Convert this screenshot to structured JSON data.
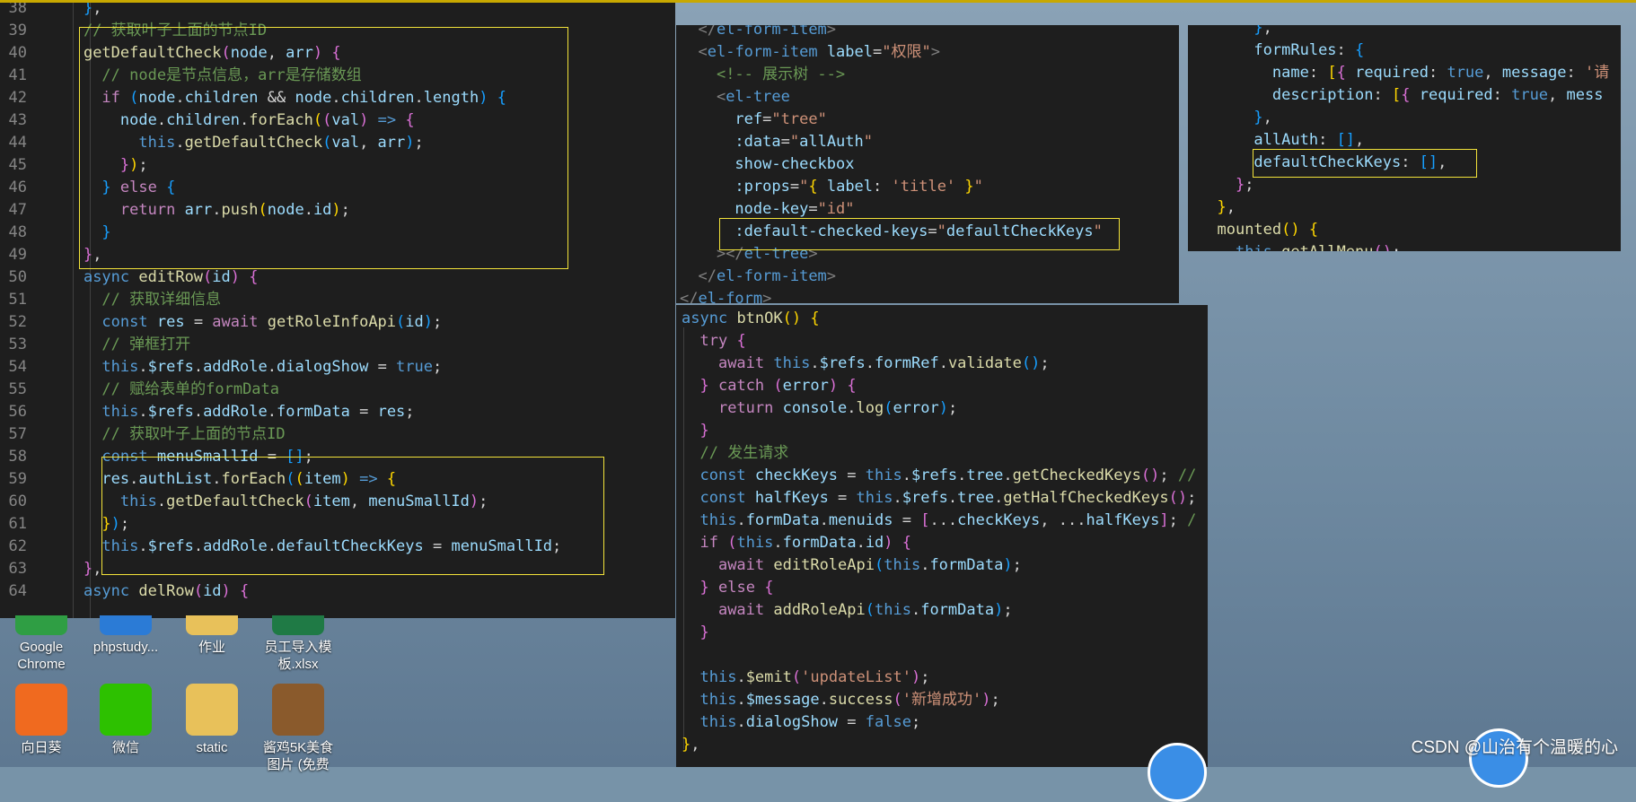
{
  "panel_left": {
    "lines": [
      {
        "n": "38",
        "html": "    <span class='b3'>}</span>,"
      },
      {
        "n": "39",
        "html": "    <span class='c'>// 获取叶子上面的节点ID</span>"
      },
      {
        "n": "40",
        "html": "    <span class='f'>getDefaultCheck</span><span class='b2'>(</span><span class='v'>node</span>, <span class='v'>arr</span><span class='b2'>)</span> <span class='b2'>{</span>"
      },
      {
        "n": "41",
        "html": "      <span class='c'>// node是节点信息，arr是存储数组</span>"
      },
      {
        "n": "42",
        "html": "      <span class='cl'>if</span> <span class='b3'>(</span><span class='v'>node</span>.<span class='v'>children</span> &amp;&amp; <span class='v'>node</span>.<span class='v'>children</span>.<span class='v'>length</span><span class='b3'>)</span> <span class='b3'>{</span>"
      },
      {
        "n": "43",
        "html": "        <span class='v'>node</span>.<span class='v'>children</span>.<span class='f'>forEach</span><span class='b1'>(</span><span class='b2'>(</span><span class='v'>val</span><span class='b2'>)</span> <span class='k'>=&gt;</span> <span class='b2'>{</span>"
      },
      {
        "n": "44",
        "html": "          <span class='k'>this</span>.<span class='f'>getDefaultCheck</span><span class='b3'>(</span><span class='v'>val</span>, <span class='v'>arr</span><span class='b3'>)</span>;"
      },
      {
        "n": "45",
        "html": "        <span class='b2'>}</span><span class='b1'>)</span>;"
      },
      {
        "n": "46",
        "html": "      <span class='b3'>}</span> <span class='cl'>else</span> <span class='b3'>{</span>"
      },
      {
        "n": "47",
        "html": "        <span class='cl'>return</span> <span class='v'>arr</span>.<span class='f'>push</span><span class='b1'>(</span><span class='v'>node</span>.<span class='v'>id</span><span class='b1'>)</span>;"
      },
      {
        "n": "48",
        "html": "      <span class='b3'>}</span>"
      },
      {
        "n": "49",
        "html": "    <span class='b2'>}</span>,"
      },
      {
        "n": "50",
        "html": "    <span class='k'>async</span> <span class='f'>editRow</span><span class='b2'>(</span><span class='v'>id</span><span class='b2'>)</span> <span class='b2'>{</span>"
      },
      {
        "n": "51",
        "html": "      <span class='c'>// 获取详细信息</span>"
      },
      {
        "n": "52",
        "html": "      <span class='k'>const</span> <span class='v'>res</span> = <span class='cl'>await</span> <span class='f'>getRoleInfoApi</span><span class='b3'>(</span><span class='v'>id</span><span class='b3'>)</span>;"
      },
      {
        "n": "53",
        "html": "      <span class='c'>// 弹框打开</span>"
      },
      {
        "n": "54",
        "html": "      <span class='k'>this</span>.<span class='v'>$refs</span>.<span class='v'>addRole</span>.<span class='v'>dialogShow</span> = <span class='k'>true</span>;"
      },
      {
        "n": "55",
        "html": "      <span class='c'>// 赋给表单的formData</span>"
      },
      {
        "n": "56",
        "html": "      <span class='k'>this</span>.<span class='v'>$refs</span>.<span class='v'>addRole</span>.<span class='v'>formData</span> = <span class='v'>res</span>;"
      },
      {
        "n": "57",
        "html": "      <span class='c'>// 获取叶子上面的节点ID</span>"
      },
      {
        "n": "58",
        "html": "      <span class='k'>const</span> <span class='v'>menuSmallId</span> = <span class='b3'>[]</span>;"
      },
      {
        "n": "59",
        "html": "      <span class='v'>res</span>.<span class='v'>authList</span>.<span class='f'>forEach</span><span class='b3'>(</span><span class='b1'>(</span><span class='v'>item</span><span class='b1'>)</span> <span class='k'>=&gt;</span> <span class='b1'>{</span>"
      },
      {
        "n": "60",
        "html": "        <span class='k'>this</span>.<span class='f'>getDefaultCheck</span><span class='b2'>(</span><span class='v'>item</span>, <span class='v'>menuSmallId</span><span class='b2'>)</span>;"
      },
      {
        "n": "61",
        "html": "      <span class='b1'>}</span><span class='b3'>)</span>;"
      },
      {
        "n": "62",
        "html": "      <span class='k'>this</span>.<span class='v'>$refs</span>.<span class='v'>addRole</span>.<span class='v'>defaultCheckKeys</span> = <span class='v'>menuSmallId</span>;"
      },
      {
        "n": "63",
        "html": "    <span class='b2'>}</span>,"
      },
      {
        "n": "64",
        "html": "    <span class='k'>async</span> <span class='f'>delRow</span><span class='b2'>(</span><span class='v'>id</span><span class='b2'>)</span> <span class='b2'>{</span>"
      }
    ]
  },
  "panel_mid_top": {
    "lines": [
      "  <span class='g'>&lt;/</span><span class='t'>el-form-item</span><span class='g'>&gt;</span>",
      "  <span class='g'>&lt;</span><span class='t'>el-form-item</span> <span class='a'>label</span>=<span class='s'>\"权限\"</span><span class='g'>&gt;</span>",
      "    <span class='c'>&lt;!-- 展示树 --&gt;</span>",
      "    <span class='g'>&lt;</span><span class='t'>el-tree</span>",
      "      <span class='a'>ref</span>=<span class='s'>\"tree\"</span>",
      "      <span class='a'>:data</span>=<span class='s'>\"</span><span class='v'>allAuth</span><span class='s'>\"</span>",
      "      <span class='a'>show-checkbox</span>",
      "      <span class='a'>:props</span>=<span class='s'>\"</span><span class='b1'>{</span> <span class='v'>label</span>: <span class='s'>'title'</span> <span class='b1'>}</span><span class='s'>\"</span>",
      "      <span class='a'>node-key</span>=<span class='s'>\"id\"</span>",
      "      <span class='a'>:default-checked-keys</span>=<span class='s'>\"</span><span class='v'>defaultCheckKeys</span><span class='s'>\"</span>",
      "    <span class='g'>&gt;&lt;/</span><span class='t'>el-tree</span><span class='g'>&gt;</span>",
      "  <span class='g'>&lt;/</span><span class='t'>el-form-item</span><span class='g'>&gt;</span>",
      "<span class='g'>&lt;/</span><span class='t'>el-form</span><span class='g'>&gt;</span>"
    ]
  },
  "panel_right_top": {
    "lines": [
      "      <span class='b3'>}</span>,",
      "      <span class='v'>formRules</span>: <span class='b3'>{</span>",
      "        <span class='v'>name</span>: <span class='b1'>[</span><span class='b2'>{</span> <span class='v'>required</span>: <span class='k'>true</span>, <span class='v'>message</span>: <span class='s'>'请</span>",
      "        <span class='v'>description</span>: <span class='b1'>[</span><span class='b2'>{</span> <span class='v'>required</span>: <span class='k'>true</span>, <span class='v'>mess</span>",
      "      <span class='b3'>}</span>,",
      "      <span class='v'>allAuth</span>: <span class='b3'>[]</span>,",
      "      <span class='v'>defaultCheckKeys</span>: <span class='b3'>[]</span>,",
      "    <span class='b2'>}</span>;",
      "  <span class='b1'>}</span>,",
      "  <span class='f'>mounted</span><span class='b1'>()</span> <span class='b1'>{</span>",
      "    <span class='k'>this</span>.<span class='f'>getAllMenu</span><span class='b2'>()</span>;"
    ]
  },
  "panel_mid_bottom": {
    "lines": [
      "<span class='k'>async</span> <span class='f'>btnOK</span><span class='b1'>()</span> <span class='b1'>{</span>",
      "  <span class='cl'>try</span> <span class='b2'>{</span>",
      "    <span class='cl'>await</span> <span class='k'>this</span>.<span class='v'>$refs</span>.<span class='v'>formRef</span>.<span class='f'>validate</span><span class='b3'>()</span>;",
      "  <span class='b2'>}</span> <span class='cl'>catch</span> <span class='b2'>(</span><span class='v'>error</span><span class='b2'>)</span> <span class='b2'>{</span>",
      "    <span class='cl'>return</span> <span class='v'>console</span>.<span class='f'>log</span><span class='b3'>(</span><span class='v'>error</span><span class='b3'>)</span>;",
      "  <span class='b2'>}</span>",
      "  <span class='c'>// 发生请求</span>",
      "  <span class='k'>const</span> <span class='v'>checkKeys</span> = <span class='k'>this</span>.<span class='v'>$refs</span>.<span class='v'>tree</span>.<span class='f'>getCheckedKeys</span><span class='b2'>()</span>; <span class='c'>//</span>",
      "  <span class='k'>const</span> <span class='v'>halfKeys</span> = <span class='k'>this</span>.<span class='v'>$refs</span>.<span class='v'>tree</span>.<span class='f'>getHalfCheckedKeys</span><span class='b2'>()</span>;",
      "  <span class='k'>this</span>.<span class='v'>formData</span>.<span class='v'>menuids</span> = <span class='b2'>[</span>...<span class='v'>checkKeys</span>, ...<span class='v'>halfKeys</span><span class='b2'>]</span>; <span class='c'>/</span>",
      "  <span class='cl'>if</span> <span class='b2'>(</span><span class='k'>this</span>.<span class='v'>formData</span>.<span class='v'>id</span><span class='b2'>)</span> <span class='b2'>{</span>",
      "    <span class='cl'>await</span> <span class='f'>editRoleApi</span><span class='b3'>(</span><span class='k'>this</span>.<span class='v'>formData</span><span class='b3'>)</span>;",
      "  <span class='b2'>}</span> <span class='cl'>else</span> <span class='b2'>{</span>",
      "    <span class='cl'>await</span> <span class='f'>addRoleApi</span><span class='b3'>(</span><span class='k'>this</span>.<span class='v'>formData</span><span class='b3'>)</span>;",
      "  <span class='b2'>}</span>",
      "",
      "  <span class='k'>this</span>.<span class='f'>$emit</span><span class='b2'>(</span><span class='s'>'updateList'</span><span class='b2'>)</span>;",
      "  <span class='k'>this</span>.<span class='v'>$message</span>.<span class='f'>success</span><span class='b2'>(</span><span class='s'>'新增成功'</span><span class='b2'>)</span>;",
      "  <span class='k'>this</span>.<span class='v'>dialogShow</span> = <span class='k'>false</span>;",
      "<span class='b1'>}</span>,"
    ]
  },
  "desktop_icons": [
    {
      "label": "Google Chrome",
      "icon": "chrome-icon",
      "color": "#2f9e44"
    },
    {
      "label": "phpstudy...",
      "icon": "phpstudy-icon",
      "color": "#2b7bd6"
    },
    {
      "label": "作业",
      "icon": "folder-icon",
      "color": "#e8c15a"
    },
    {
      "label": "员工导入模板.xlsx",
      "icon": "excel-icon",
      "color": "#1f7a45"
    },
    {
      "label": "向日葵",
      "icon": "sunflower-icon",
      "color": "#f06a1f"
    },
    {
      "label": "微信",
      "icon": "wechat-icon",
      "color": "#2dc100"
    },
    {
      "label": "static",
      "icon": "folder-icon",
      "color": "#e8c15a"
    },
    {
      "label": "酱鸡5K美食图片 (免费",
      "icon": "image-icon",
      "color": "#8a5a2c"
    }
  ],
  "watermark": "CSDN @山治有个温暖的心"
}
